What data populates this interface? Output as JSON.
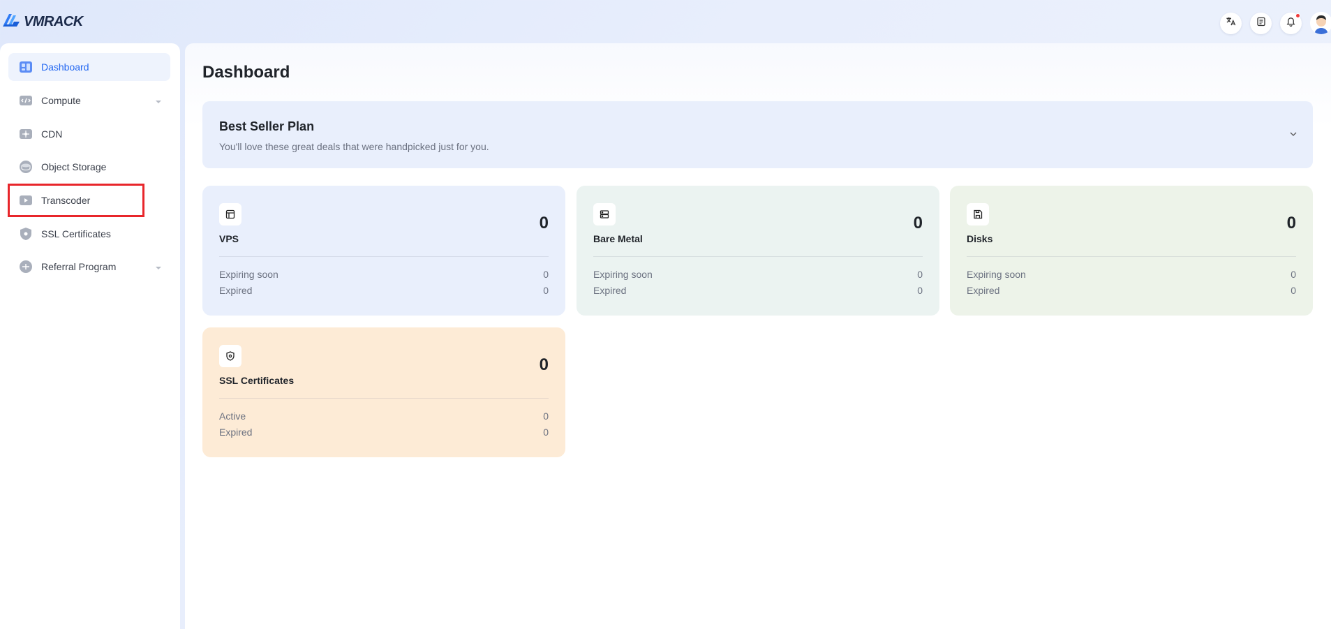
{
  "app": {
    "logo_text": "VMRACK"
  },
  "colors": {
    "accent": "#2468f2",
    "highlight": "#e8262b",
    "notification": "#f03a3a"
  },
  "topbar": {
    "icons": [
      "translate-icon",
      "document-icon",
      "bell-icon",
      "avatar"
    ]
  },
  "sidebar": {
    "items": [
      {
        "label": "Dashboard",
        "icon": "dashboard-icon",
        "active": true
      },
      {
        "label": "Compute",
        "icon": "compute-icon",
        "expandable": true
      },
      {
        "label": "CDN",
        "icon": "cdn-icon"
      },
      {
        "label": "Object Storage",
        "icon": "object-storage-icon"
      },
      {
        "label": "Transcoder",
        "icon": "transcoder-icon",
        "highlighted": true
      },
      {
        "label": "SSL Certificates",
        "icon": "ssl-icon"
      },
      {
        "label": "Referral Program",
        "icon": "referral-icon",
        "expandable": true
      }
    ]
  },
  "main": {
    "title": "Dashboard",
    "banner": {
      "title": "Best Seller Plan",
      "subtitle": "You'll love these great deals that were handpicked just for you."
    },
    "cards": [
      {
        "title": "VPS",
        "icon": "vps-icon",
        "count": "0",
        "rows": [
          {
            "label": "Expiring soon",
            "value": "0"
          },
          {
            "label": "Expired",
            "value": "0"
          }
        ]
      },
      {
        "title": "Bare Metal",
        "icon": "server-icon",
        "count": "0",
        "rows": [
          {
            "label": "Expiring soon",
            "value": "0"
          },
          {
            "label": "Expired",
            "value": "0"
          }
        ]
      },
      {
        "title": "Disks",
        "icon": "disk-icon",
        "count": "0",
        "rows": [
          {
            "label": "Expiring soon",
            "value": "0"
          },
          {
            "label": "Expired",
            "value": "0"
          }
        ]
      },
      {
        "title": "SSL Certificates",
        "icon": "shield-icon",
        "count": "0",
        "rows": [
          {
            "label": "Active",
            "value": "0"
          },
          {
            "label": "Expired",
            "value": "0"
          }
        ]
      }
    ]
  }
}
